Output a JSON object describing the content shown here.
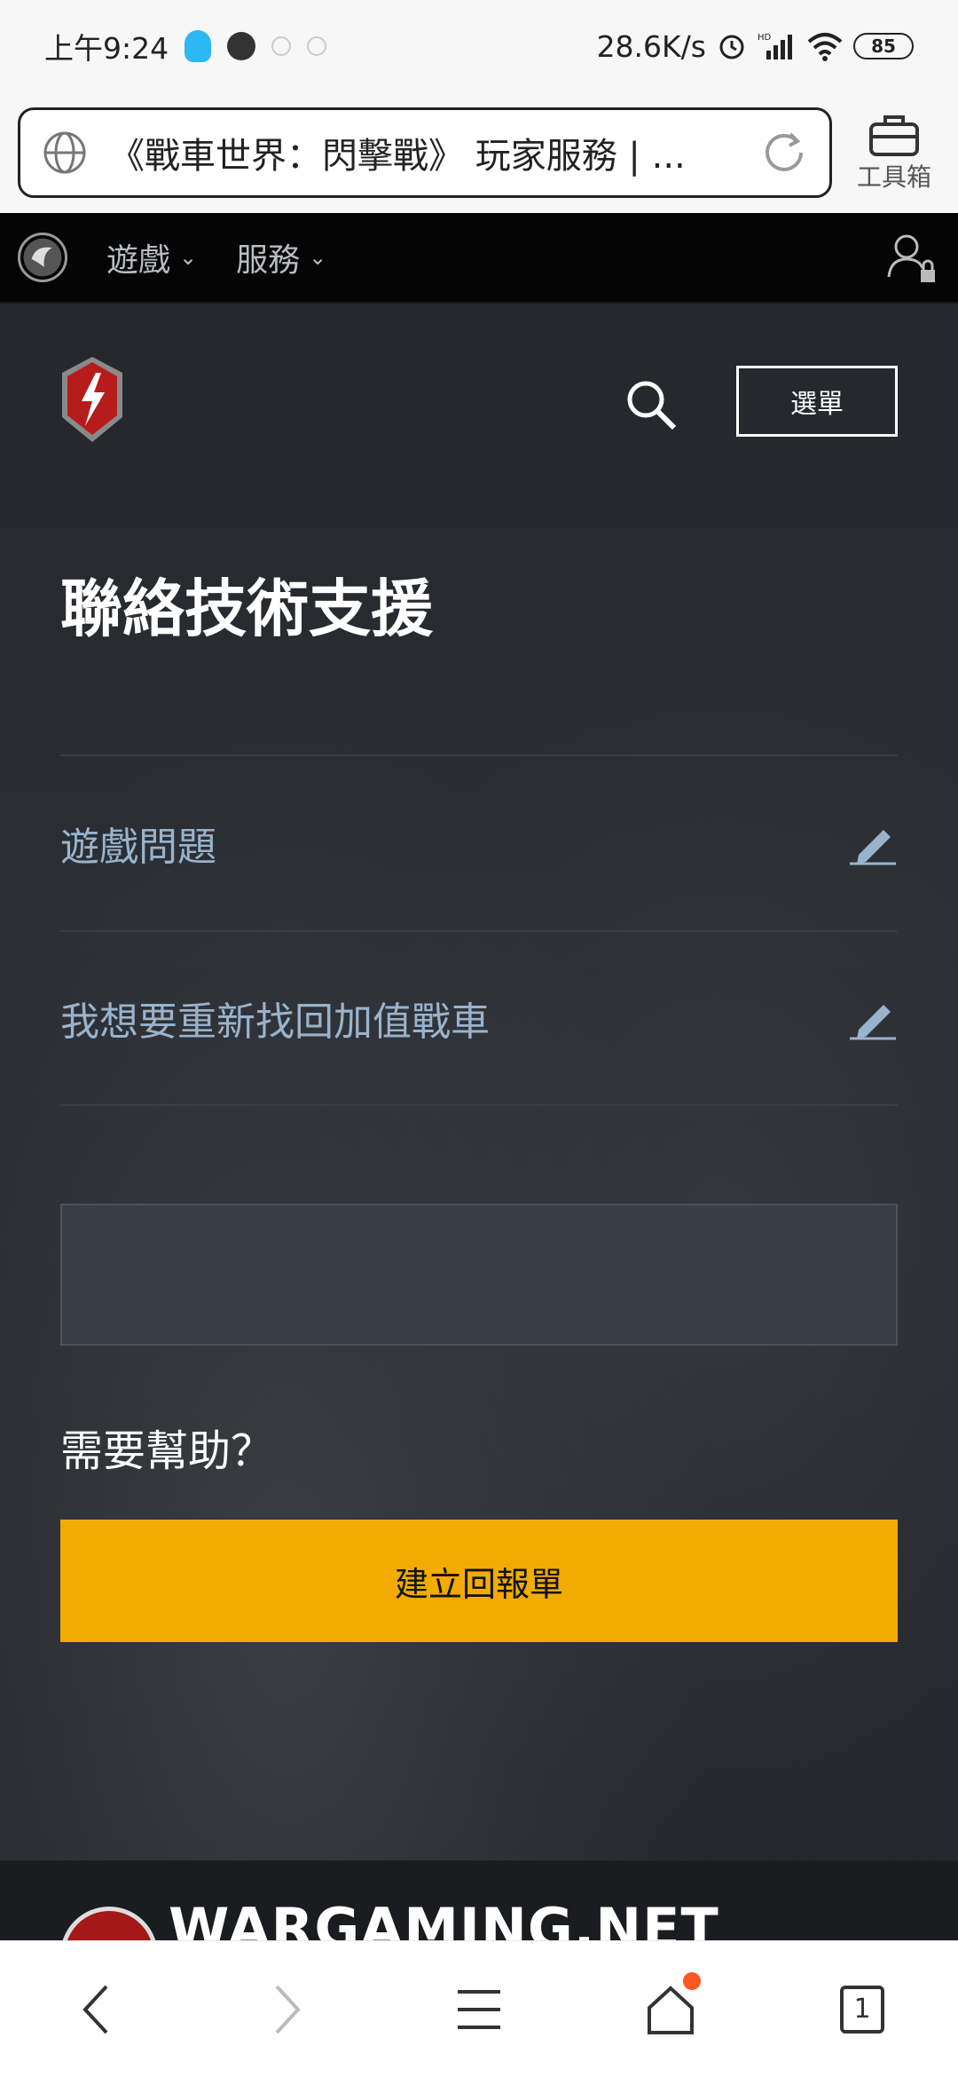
{
  "status_bar": {
    "time": "上午9:24",
    "network_speed": "28.6K/s",
    "battery": "85"
  },
  "browser": {
    "address_text": "《戰車世界：閃擊戰》 玩家服務 | ...",
    "toolbox_label": "工具箱",
    "tabs_count": "1"
  },
  "site": {
    "nav": {
      "games_label": "遊戲",
      "services_label": "服務"
    },
    "menu_label": "選單",
    "title": "聯絡技術支援",
    "rows": [
      {
        "label": "遊戲問題"
      },
      {
        "label": "我想要重新找回加值戰車"
      }
    ],
    "input_value": "",
    "need_help": "需要幫助？",
    "ticket_button": "建立回報單",
    "footer_brand": "WARGAMING.NET"
  },
  "colors": {
    "accent_yellow": "#f2ab00",
    "link_blue": "#99b3cc",
    "site_bg": "#26292e"
  },
  "icons": [
    "globe-icon",
    "refresh-icon",
    "toolbox-icon",
    "wg-logo-icon",
    "chevron-down-icon",
    "user-lock-icon",
    "blitz-logo-icon",
    "search-icon",
    "edit-pencil-icon",
    "back-icon",
    "forward-icon",
    "menu-icon",
    "home-icon"
  ]
}
